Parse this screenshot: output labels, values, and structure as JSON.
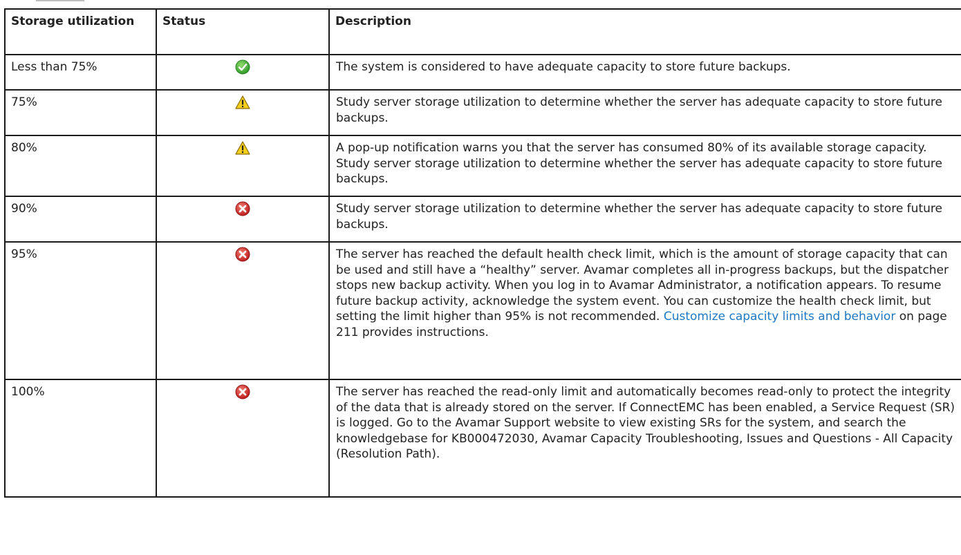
{
  "table": {
    "headers": [
      "Storage utilization",
      "Status",
      "Description"
    ],
    "rows": [
      {
        "utilization": "Less than 75%",
        "status_icon": "ok-check-icon",
        "status_color": "#3aa635",
        "description": "The system is considered to have adequate capacity to store future backups."
      },
      {
        "utilization": "75%",
        "status_icon": "warning-triangle-icon",
        "status_color": "#f2c516",
        "description": "Study server storage utilization to determine whether the server has adequate capacity to store future backups."
      },
      {
        "utilization": "80%",
        "status_icon": "warning-triangle-icon",
        "status_color": "#f2c516",
        "description": "A pop-up notification warns you that the server has consumed 80% of its available storage capacity. Study server storage utilization to determine whether the server has adequate capacity to store future backups."
      },
      {
        "utilization": "90%",
        "status_icon": "error-x-icon",
        "status_color": "#d92a2a",
        "description": "Study server storage utilization to determine whether the server has adequate capacity to store future backups."
      },
      {
        "utilization": "95%",
        "status_icon": "error-x-icon",
        "status_color": "#d92a2a",
        "description_before": "The server has reached the default health check limit, which is the amount of storage capacity that can be used and still have a “healthy” server. Avamar completes all in-progress backups, but the dispatcher stops new backup activity. When you log in to Avamar Administrator, a notification appears. To resume future backup activity, acknowledge the system event. You can customize the health check limit, but setting the limit higher than 95% is not recommended.",
        "description_link": "Customize capacity limits and behavior",
        "description_after": "on page 211 provides instructions."
      },
      {
        "utilization": "100%",
        "status_icon": "error-x-icon",
        "status_color": "#d92a2a",
        "description": "The server has reached the read-only limit and automatically becomes read-only to protect the integrity of the data that is already stored on the server. If ConnectEMC has been enabled, a Service Request (SR) is logged. Go to the Avamar Support website to view existing SRs for the system, and search the knowledgebase for KB000472030, Avamar Capacity Troubleshooting, Issues and Questions - All Capacity (Resolution Path)."
      }
    ]
  },
  "colors": {
    "link": "#1e78c2",
    "border": "#1a1a1a"
  }
}
